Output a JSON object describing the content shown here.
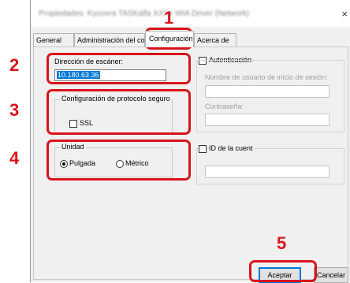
{
  "window": {
    "title": "Propiedades: Kyocera TASKalfa XXXx WIA Driver (Network)",
    "close_glyph": "×"
  },
  "tabs": [
    "General",
    "Administración del color",
    "Configuración",
    "Acerca de"
  ],
  "active_tab": "Configuración",
  "scanner": {
    "label": "Dirección de escáner:",
    "value": "10.180.63.36"
  },
  "secure": {
    "title": "Configuración de protocolo seguro",
    "ssl_label": "SSL",
    "ssl_checked": false
  },
  "unit": {
    "title": "Unidad",
    "options": [
      "Pulgada",
      "Métrico"
    ],
    "selected": "Pulgada"
  },
  "auth": {
    "label": "Autenticación",
    "checked": false,
    "username_label": "Nombre de usuario de inicio de sesión:",
    "password_label": "Contraseña:"
  },
  "account": {
    "label": "ID de la cuent",
    "checked": false
  },
  "buttons": {
    "ok": "Aceptar",
    "cancel": "Cancelar"
  },
  "callouts": [
    "1",
    "2",
    "3",
    "4",
    "5"
  ],
  "colors": {
    "callout": "#d8141a",
    "selection": "#0078d7",
    "ok_border": "#0078d7"
  }
}
